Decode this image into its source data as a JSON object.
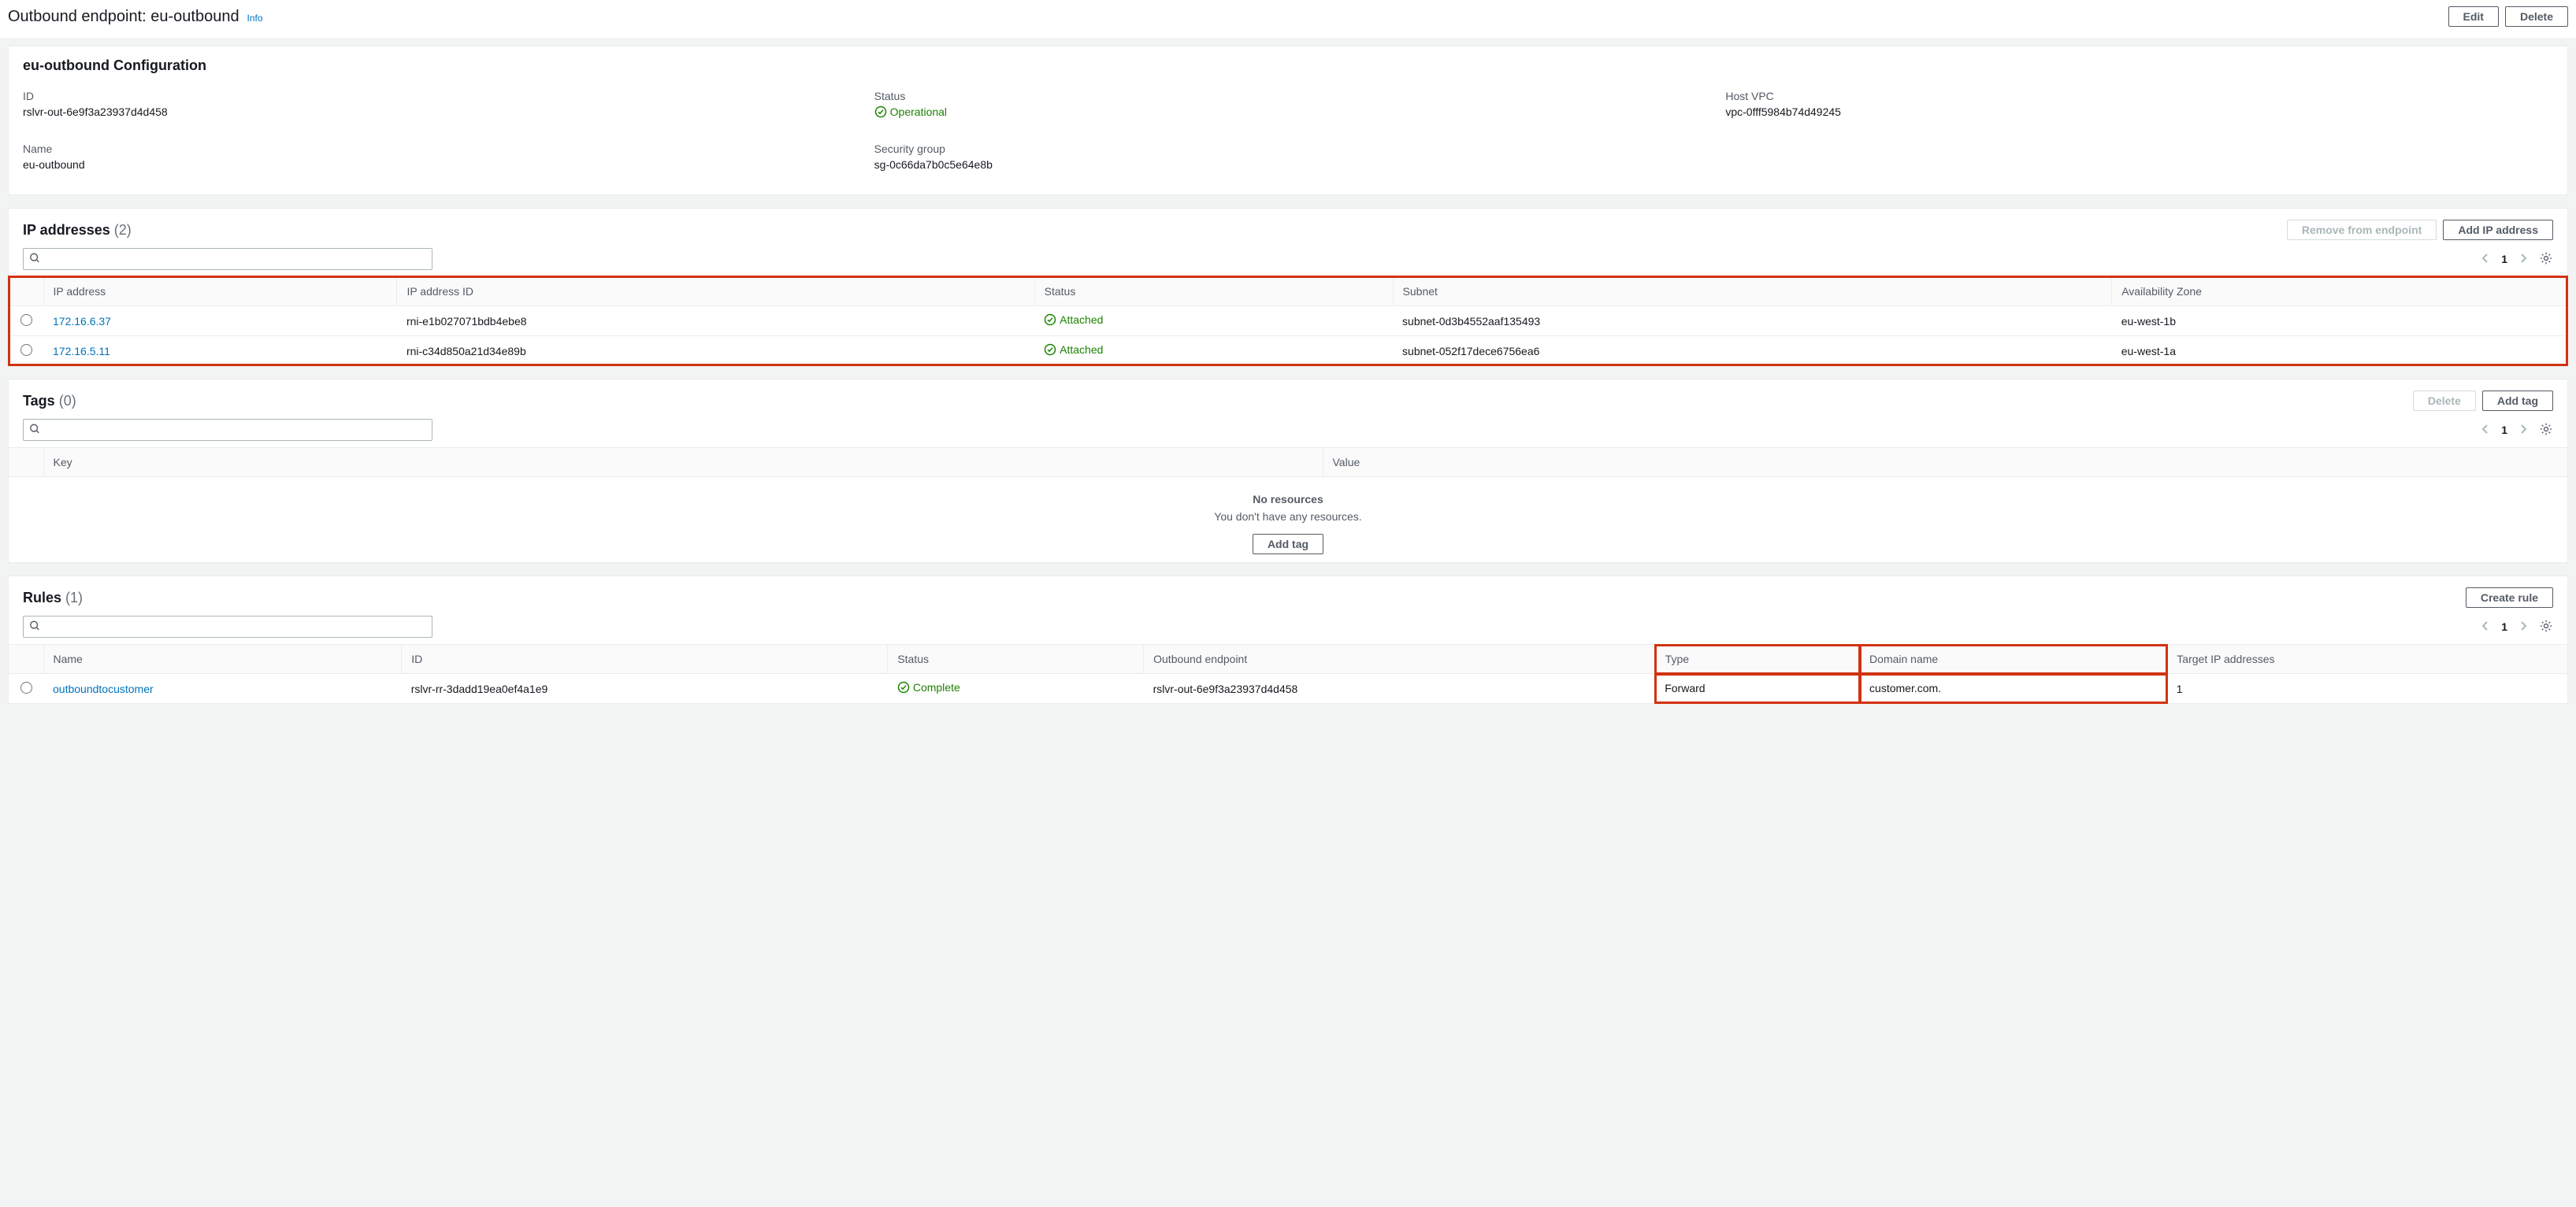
{
  "header": {
    "prefix": "Outbound endpoint: ",
    "name": "eu-outbound",
    "info": "Info",
    "edit": "Edit",
    "delete": "Delete"
  },
  "config": {
    "title": "eu-outbound Configuration",
    "id_label": "ID",
    "id_value": "rslvr-out-6e9f3a23937d4d458",
    "status_label": "Status",
    "status_value": "Operational",
    "hostvpc_label": "Host VPC",
    "hostvpc_value": "vpc-0fff5984b74d49245",
    "name_label": "Name",
    "name_value": "eu-outbound",
    "sg_label": "Security group",
    "sg_value": "sg-0c66da7b0c5e64e8b"
  },
  "ip": {
    "title": "IP addresses",
    "count": "(2)",
    "remove": "Remove from endpoint",
    "add": "Add IP address",
    "page": "1",
    "cols": {
      "ip": "IP address",
      "ipid": "IP address ID",
      "status": "Status",
      "subnet": "Subnet",
      "az": "Availability Zone"
    },
    "rows": [
      {
        "ip": "172.16.6.37",
        "ipid": "rni-e1b027071bdb4ebe8",
        "status": "Attached",
        "subnet": "subnet-0d3b4552aaf135493",
        "az": "eu-west-1b"
      },
      {
        "ip": "172.16.5.11",
        "ipid": "rni-c34d850a21d34e89b",
        "status": "Attached",
        "subnet": "subnet-052f17dece6756ea6",
        "az": "eu-west-1a"
      }
    ]
  },
  "tags": {
    "title": "Tags",
    "count": "(0)",
    "delete": "Delete",
    "add": "Add tag",
    "page": "1",
    "cols": {
      "key": "Key",
      "value": "Value"
    },
    "empty_title": "No resources",
    "empty_msg": "You don't have any resources.",
    "empty_btn": "Add tag"
  },
  "rules": {
    "title": "Rules",
    "count": "(1)",
    "create": "Create rule",
    "page": "1",
    "cols": {
      "name": "Name",
      "id": "ID",
      "status": "Status",
      "outbound": "Outbound endpoint",
      "type": "Type",
      "domain": "Domain name",
      "targets": "Target IP addresses"
    },
    "rows": [
      {
        "name": "outboundtocustomer",
        "id": "rslvr-rr-3dadd19ea0ef4a1e9",
        "status": "Complete",
        "outbound": "rslvr-out-6e9f3a23937d4d458",
        "type": "Forward",
        "domain": "customer.com.",
        "targets": "1"
      }
    ]
  }
}
